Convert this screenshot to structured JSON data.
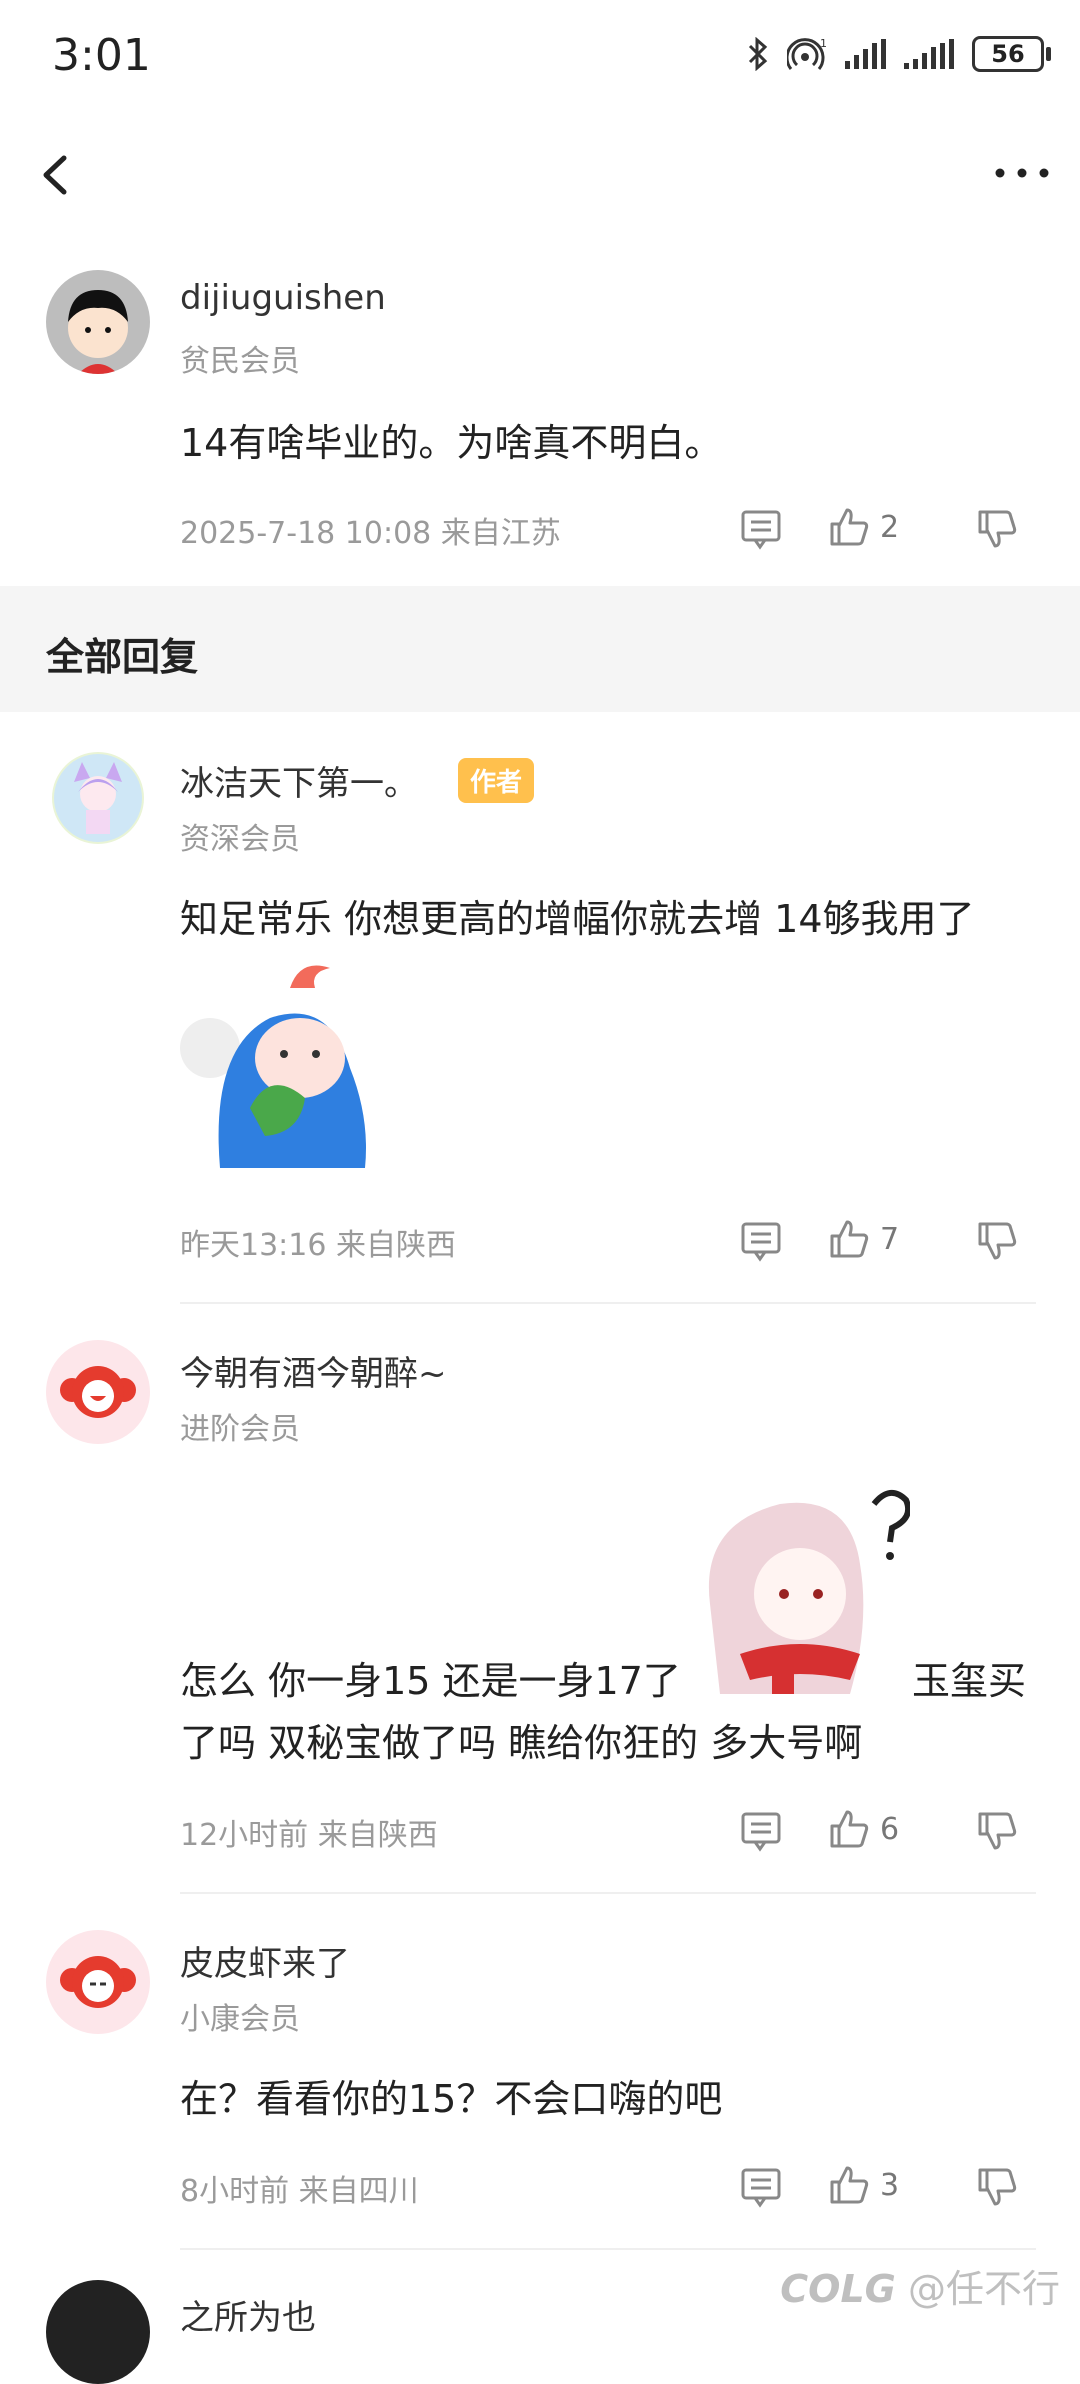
{
  "status_bar": {
    "time": "3:01",
    "battery": "56"
  },
  "post": {
    "username": "dijiuguishen",
    "level": "贫民会员",
    "content": "14有啥毕业的。为啥真不明白。",
    "time_location": "2025-7-18 10:08 来自江苏",
    "likes": "2"
  },
  "section": {
    "title": "全部回复"
  },
  "replies": [
    {
      "username": "冰洁天下第一。",
      "badge": "作者",
      "level": "资深会员",
      "content": "知足常乐 你想更高的增幅你就去增 14够我用了",
      "time_location": "昨天13:16 来自陕西",
      "likes": "7"
    },
    {
      "username": "今朝有酒今朝醉~",
      "level": "进阶会员",
      "content_line1_a": "怎么 你一身15 还是一身17了",
      "content_line1_b": "玉玺买",
      "content_line2": "了吗 双秘宝做了吗 瞧给你狂的 多大号啊",
      "time_location": "12小时前 来自陕西",
      "likes": "6"
    },
    {
      "username": "皮皮虾来了",
      "level": "小康会员",
      "content": "在？看看你的15？不会口嗨的吧",
      "time_location": "8小时前 来自四川",
      "likes": "3"
    },
    {
      "username": "之所为也"
    }
  ],
  "watermark": "@任不行",
  "watermark_logo": "COLG",
  "colors": {
    "accent_badge": "#ffc04d",
    "section_bg": "#f5f5f5",
    "meta_text": "#9a9a9a"
  },
  "icons": [
    "back-icon",
    "more-icon",
    "comment-icon",
    "thumbs-up-icon",
    "thumbs-down-icon",
    "bluetooth-icon",
    "hotspot-icon",
    "signal-icon",
    "battery-icon"
  ]
}
